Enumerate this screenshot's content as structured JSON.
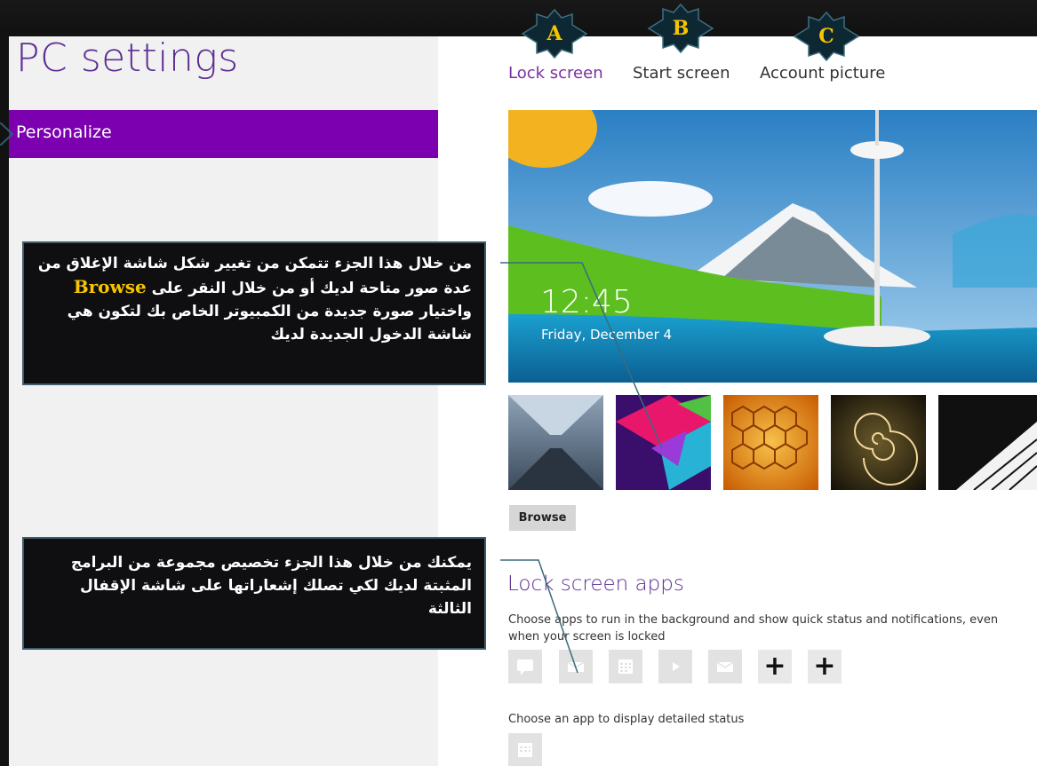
{
  "page": {
    "title": "PC settings",
    "nav_selected": "Personalize"
  },
  "tabs": [
    {
      "label": "Lock screen",
      "active": true
    },
    {
      "label": "Start screen",
      "active": false
    },
    {
      "label": "Account picture",
      "active": false
    }
  ],
  "badges": [
    "A",
    "B",
    "C"
  ],
  "lock_preview": {
    "time": "12:45",
    "date": "Friday, December 4"
  },
  "thumbnails": [
    "speed-tunnel-image",
    "colorful-cubes-image",
    "honeycomb-image",
    "nautilus-shell-image",
    "piano-keys-image"
  ],
  "browse_label": "Browse",
  "lock_apps": {
    "title": "Lock screen apps",
    "description": "Choose apps to run in the background and show quick status and notifications, even when your screen is locked",
    "apps": [
      "messaging-icon",
      "mail-icon",
      "calendar-icon",
      "video-icon",
      "mail-icon",
      "add-icon",
      "add-icon"
    ],
    "detailed_label": "Choose an app to display detailed status",
    "detailed_app": "calendar-icon"
  },
  "callouts": {
    "first_part1": "من خلال هذا الجزء تتمكن من تغيير شكل شاشة الإغلاق من عدة صور متاحة لديك أو من خلال النقر على",
    "first_highlight": "Browse",
    "first_part2": "واختيار صورة جديدة من الكمبيوتر الخاص بك لتكون هي شاشة الدخول الجديدة لديك",
    "second": "يمكنك من خلال هذا الجزء تخصيص مجموعة من البرامج المثبتة لديك لكي تصلك إشعاراتها على شاشة الإقفال الثالثة"
  },
  "colors": {
    "accent": "#7c00b0",
    "title": "#5c2d91",
    "badge_text": "#f6c400"
  }
}
